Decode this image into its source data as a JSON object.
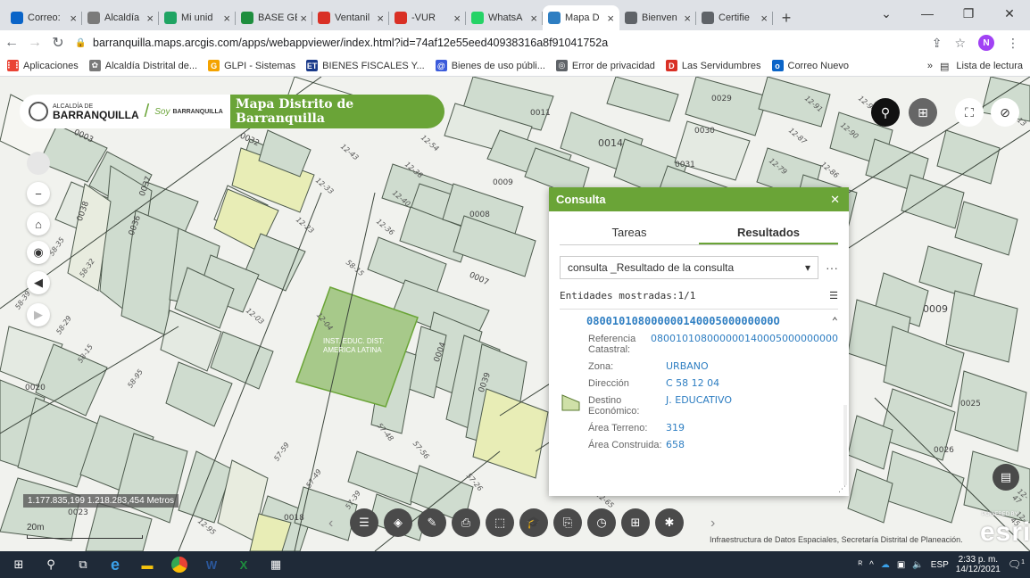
{
  "browser": {
    "tabs": [
      {
        "label": "Correo:",
        "fav_color": "#0a64c8",
        "active": false
      },
      {
        "label": "Alcaldía",
        "fav_color": "#7a7a7a",
        "active": false
      },
      {
        "label": "Mi unid",
        "fav_color": "#1fa463",
        "active": false
      },
      {
        "label": "BASE GE",
        "fav_color": "#1e8e3e",
        "active": false
      },
      {
        "label": "Ventanil",
        "fav_color": "#d93025",
        "active": false
      },
      {
        "label": "-VUR",
        "fav_color": "#d93025",
        "active": false
      },
      {
        "label": "WhatsA",
        "fav_color": "#25d366",
        "active": false
      },
      {
        "label": "Mapa D",
        "fav_color": "#2e7ec2",
        "active": true
      },
      {
        "label": "Bienven",
        "fav_color": "#5f6368",
        "active": false
      },
      {
        "label": "Certifie",
        "fav_color": "#5f6368",
        "active": false
      }
    ],
    "url": "barranquilla.maps.arcgis.com/apps/webappviewer/index.html?id=74af12e55eed40938316a8f91041752a",
    "profile_initial": "N",
    "bookmarks": [
      {
        "label": "Aplicaciones",
        "color": "#ea4335",
        "glyph": "⋮⋮"
      },
      {
        "label": "Alcaldía Distrital de...",
        "color": "#7a7a7a",
        "glyph": "✿"
      },
      {
        "label": "GLPI - Sistemas",
        "color": "#f4a300",
        "glyph": "G"
      },
      {
        "label": "BIENES FISCALES Y...",
        "color": "#1a3a8a",
        "glyph": "ET"
      },
      {
        "label": "Bienes de uso públi...",
        "color": "#3b5bdb",
        "glyph": "@"
      },
      {
        "label": "Error de privacidad",
        "color": "#5f6368",
        "glyph": "◎"
      },
      {
        "label": "Las Servidumbres",
        "color": "#d93025",
        "glyph": "D"
      },
      {
        "label": "Correo Nuevo",
        "color": "#0a64c8",
        "glyph": "o"
      }
    ],
    "reading_list": "Lista de lectura"
  },
  "app": {
    "logo_small": "ALCALDÍA DE",
    "logo_big": "BARRANQUILLA",
    "soy": "Soy",
    "soy_bq": "BARRANQUILLA",
    "title": "Mapa Distrito de Barranquilla"
  },
  "map": {
    "parcel_labels": [
      "0003",
      "0037",
      "0038",
      "0036",
      "0032",
      "0009",
      "0008",
      "0007",
      "0004",
      "0039",
      "0011",
      "0014",
      "0030",
      "0031",
      "0029",
      "0009",
      "0025",
      "0026",
      "0020",
      "0018",
      "0023"
    ],
    "road_labels": [
      "12-43",
      "12-33",
      "12-23",
      "12-38",
      "12-40",
      "12-36",
      "12-54",
      "12-58",
      "58-15",
      "12-03",
      "12-04",
      "58-35",
      "58-32",
      "58-39",
      "58-29",
      "58-15",
      "58-95",
      "57-48",
      "57-56",
      "57-26",
      "57-59",
      "57-49",
      "12-91",
      "12-87",
      "12-90",
      "12-79",
      "12-86",
      "12-94",
      "12-47",
      "12-45",
      "12-65",
      "12-95",
      "12-13",
      "57-39"
    ],
    "highlight_label": "INST. EDUC. DIST. AMERICA LATINA",
    "coords": "1.177.835,199 1.218.283,454 Metros",
    "scale": "20m",
    "attribution": "Infraestructura de Datos Espaciales, Secretaría Distrital de Planeación.",
    "esri": "esri",
    "powered": "POWERED BY"
  },
  "consulta": {
    "title": "Consulta",
    "tabs": [
      "Tareas",
      "Resultados"
    ],
    "select_value": "consulta _Resultado de la consulta",
    "entities": "Entidades mostradas:1/1",
    "result_id": "08001010800000014000500000000O",
    "attributes": [
      {
        "key": "Referencia Catastral:",
        "value": "080010108000000140005000000000"
      },
      {
        "key": "Zona:",
        "value": "URBANO"
      },
      {
        "key": "Dirección",
        "value": "C 58 12 04"
      },
      {
        "key": "Destino Económico:",
        "value": "J. EDUCATIVO"
      },
      {
        "key": "Área Terreno:",
        "value": "319"
      },
      {
        "key": "Área Construida:",
        "value": "658"
      }
    ]
  },
  "taskbar": {
    "lang": "ESP",
    "time": "2:33 p. m.",
    "date": "14/12/2021",
    "notif_count": "1"
  },
  "colors": {
    "accent_green": "#6aa437",
    "link_blue": "#2e7ec2",
    "parcel_fill": "#cfdccf",
    "parcel_highlight": "#9fc27a",
    "parcel_yellow": "#e8edb6"
  }
}
